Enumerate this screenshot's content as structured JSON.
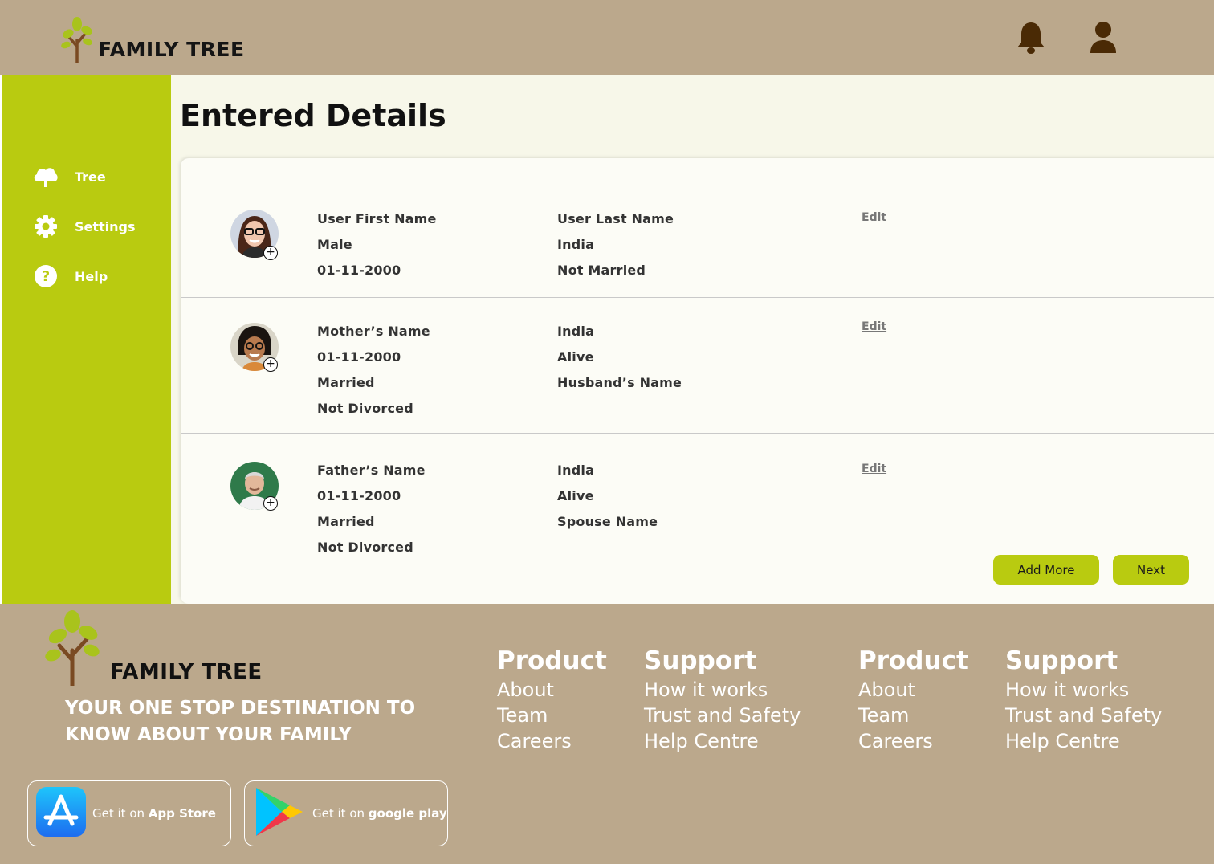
{
  "header": {
    "logo_text": "FAMILY TREE"
  },
  "sidebar": {
    "items": [
      {
        "label": "Tree",
        "icon": "tree-cloud-icon"
      },
      {
        "label": "Settings",
        "icon": "gear-icon"
      },
      {
        "label": "Help",
        "icon": "help-icon"
      }
    ]
  },
  "main": {
    "title": "Entered Details",
    "edit_label": "Edit",
    "entries": [
      {
        "left": [
          "User First Name",
          "Male",
          "01-11-2000"
        ],
        "right": [
          "User Last Name",
          "India",
          "Not Married"
        ]
      },
      {
        "left": [
          "Mother’s Name",
          "01-11-2000",
          "Married",
          "Not Divorced"
        ],
        "right": [
          "India",
          "Alive",
          "Husband’s Name"
        ]
      },
      {
        "left": [
          "Father’s Name",
          "01-11-2000",
          "Married",
          "Not Divorced"
        ],
        "right": [
          "India",
          "Alive",
          "Spouse Name"
        ]
      }
    ],
    "add_more_label": "Add More",
    "next_label": "Next"
  },
  "footer": {
    "logo_text": "FAMILY TREE",
    "tagline_line1": "YOUR ONE STOP DESTINATION TO",
    "tagline_line2": "KNOW ABOUT YOUR FAMILY",
    "columns": [
      {
        "heading": "Product",
        "links": [
          "About",
          "Team",
          "Careers"
        ]
      },
      {
        "heading": "Support",
        "links": [
          "How it works",
          "Trust and Safety",
          "Help Centre"
        ]
      },
      {
        "heading": "Product",
        "links": [
          "About",
          "Team",
          "Careers"
        ]
      },
      {
        "heading": "Support",
        "links": [
          "How it works",
          "Trust and Safety",
          "Help Centre"
        ]
      }
    ],
    "app_store": {
      "prefix": "Get it on ",
      "name": "App Store"
    },
    "google_play": {
      "prefix": "Get it on ",
      "name": "google play"
    }
  },
  "colors": {
    "brand_tan": "#bba88c",
    "accent_lime": "#b9cb10",
    "content_bg": "#f7f7e9",
    "icon_brown": "#4a2a05"
  }
}
